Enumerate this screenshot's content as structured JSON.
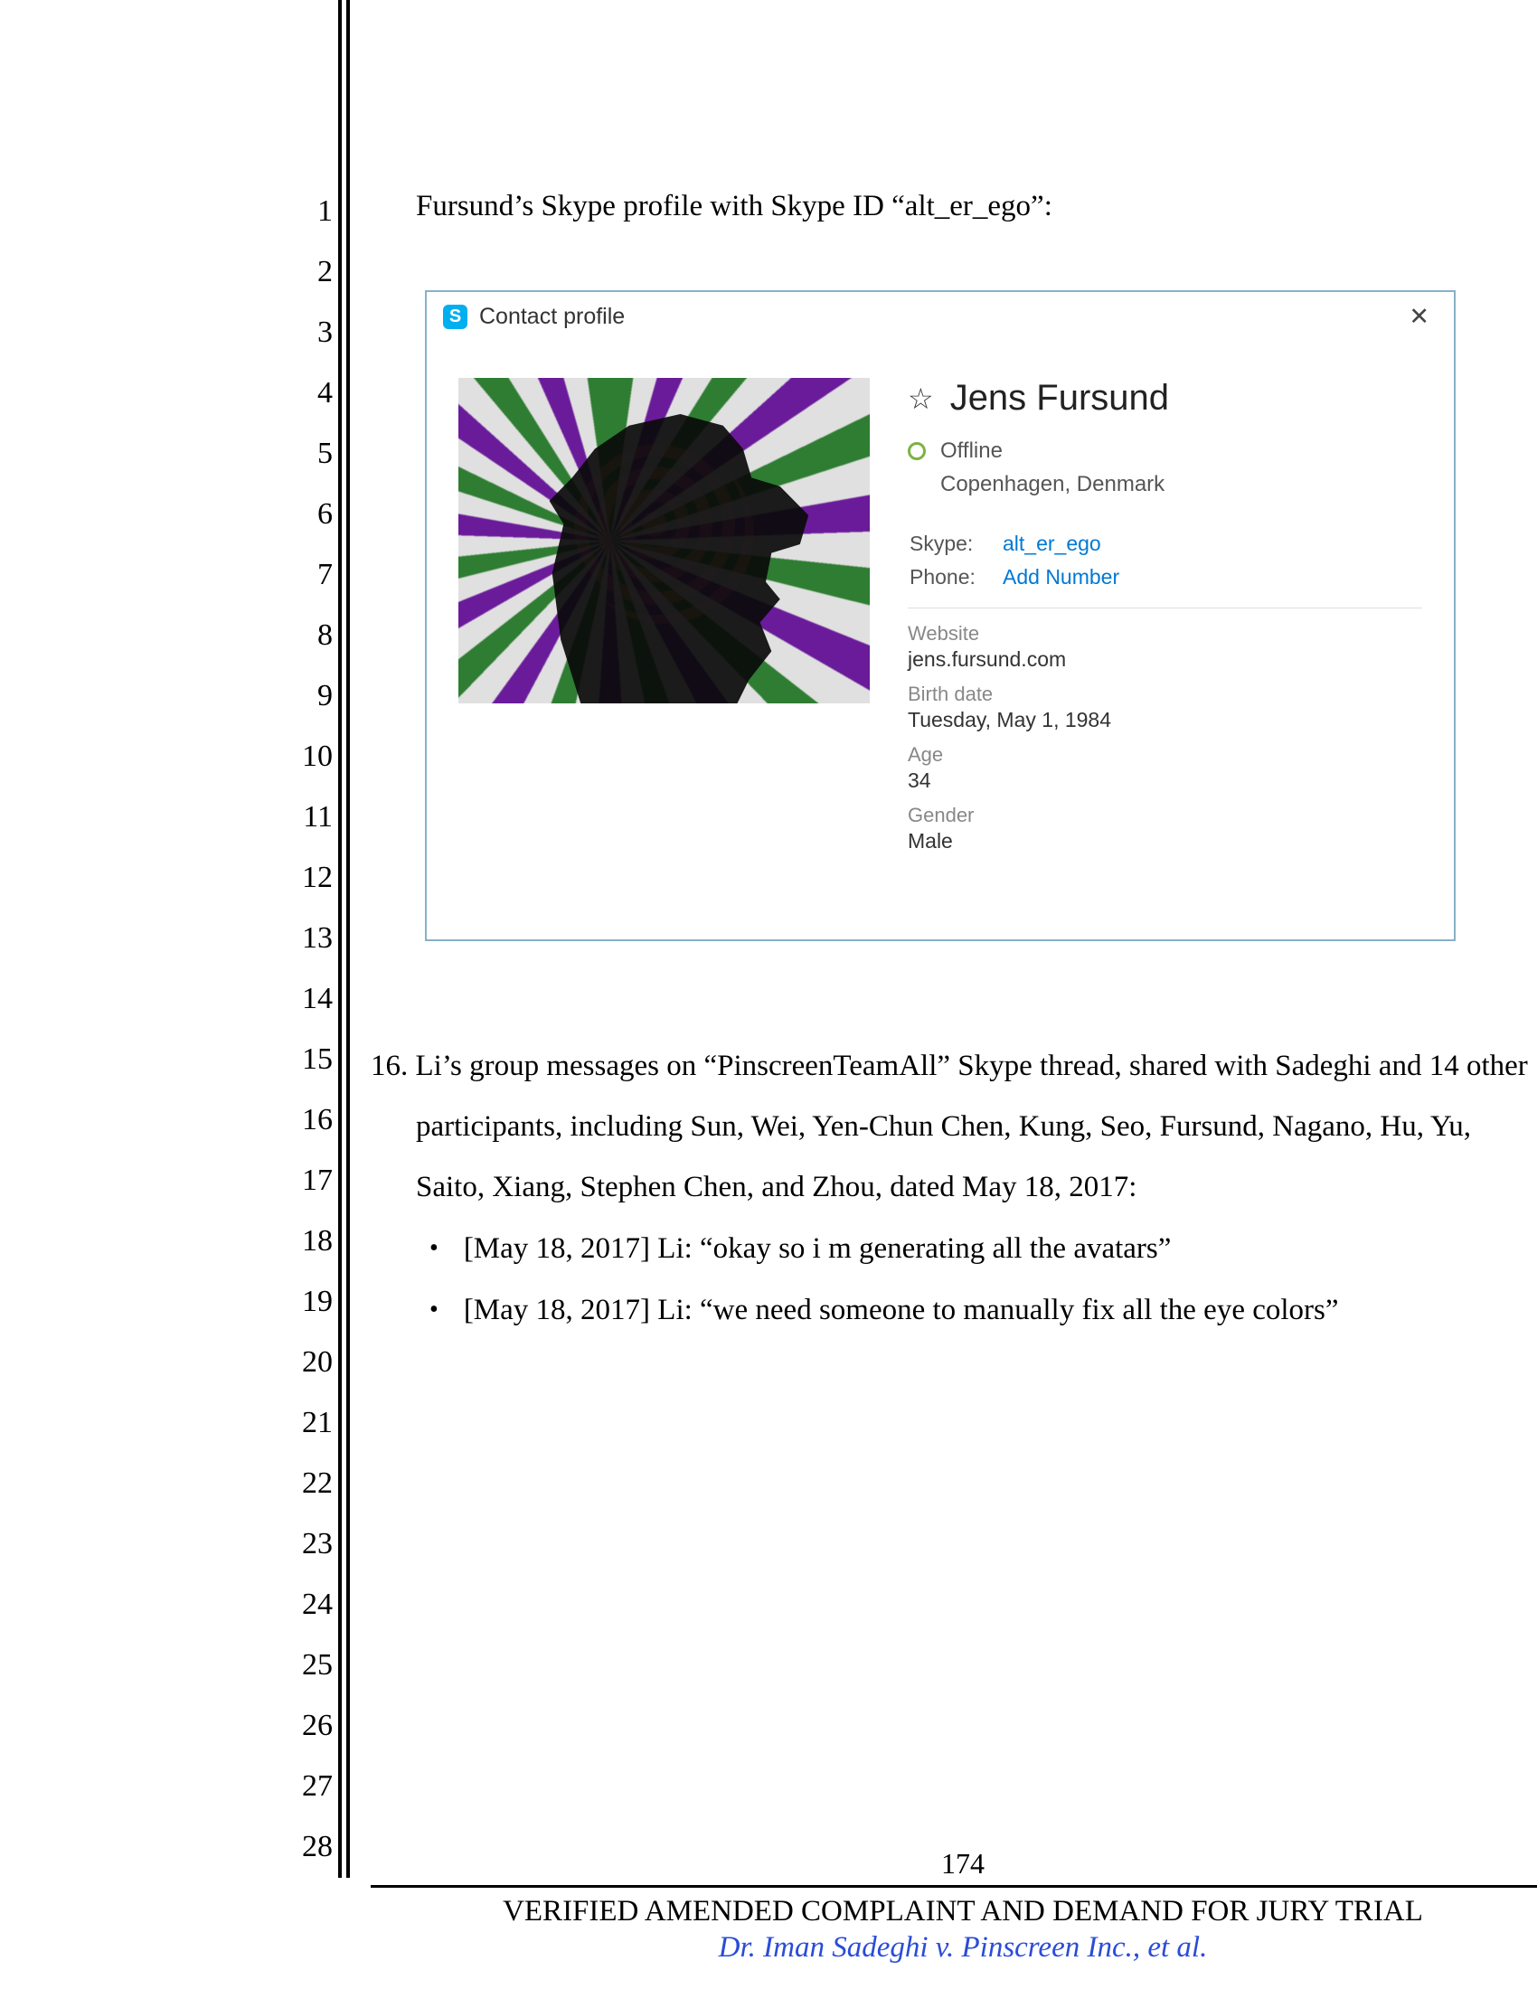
{
  "intro": "Fursund’s Skype profile with Skype ID “alt_er_ego”:",
  "line_numbers": [
    "1",
    "2",
    "3",
    "4",
    "5",
    "6",
    "7",
    "8",
    "9",
    "10",
    "11",
    "12",
    "13",
    "14",
    "15",
    "16",
    "17",
    "18",
    "19",
    "20",
    "21",
    "22",
    "23",
    "24",
    "25",
    "26",
    "27",
    "28"
  ],
  "skype": {
    "window_title": "Contact profile",
    "logo_letter": "S",
    "close": "✕",
    "star": "☆",
    "name": "Jens Fursund",
    "status": "Offline",
    "location": "Copenhagen, Denmark",
    "skype_label": "Skype:",
    "skype_id": "alt_er_ego",
    "phone_label": "Phone:",
    "phone_action": "Add Number",
    "website_label": "Website",
    "website_value": "jens.fursund.com",
    "birth_label": "Birth date",
    "birth_value": "Tuesday, May 1, 1984",
    "age_label": "Age",
    "age_value": "34",
    "gender_label": "Gender",
    "gender_value": "Male"
  },
  "item16": {
    "line1": "16. Li’s group messages on “PinscreenTeamAll” Skype thread, shared with Sadeghi and 14 other",
    "line2": "participants, including Sun, Wei, Yen-Chun Chen, Kung, Seo, Fursund, Nagano, Hu, Yu,",
    "line3": "Saito, Xiang, Stephen Chen, and Zhou, dated May 18, 2017:",
    "bullet1": "[May 18, 2017] Li: “okay so i m generating all the avatars”",
    "bullet2": "[May 18, 2017] Li: “we need someone to manually fix all the eye colors”"
  },
  "footer": {
    "page": "174",
    "title": "VERIFIED AMENDED COMPLAINT AND DEMAND FOR JURY TRIAL",
    "case": "Dr. Iman Sadeghi v. Pinscreen Inc., et al."
  }
}
